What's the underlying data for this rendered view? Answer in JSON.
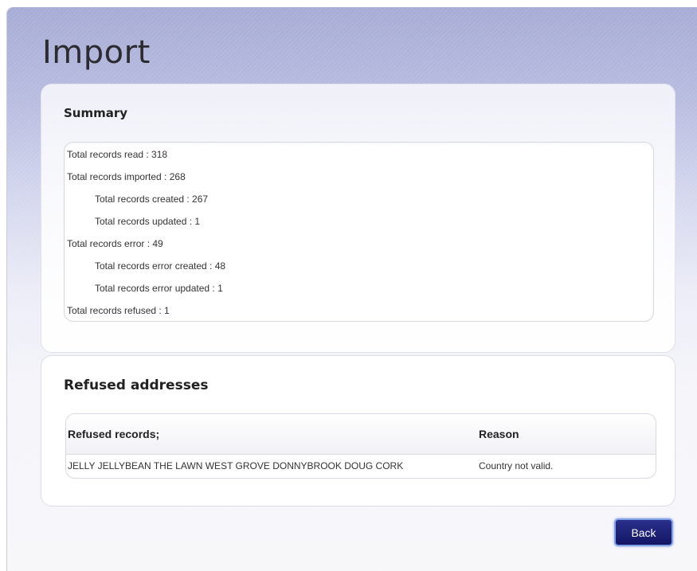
{
  "page": {
    "title": "Import"
  },
  "summary": {
    "title": "Summary",
    "lines": [
      "Total records read : 318",
      "Total records imported : 268",
      "Total records created : 267",
      "Total records updated : 1",
      "Total records error : 49",
      "Total records error created : 48",
      "Total records error updated : 1",
      "Total records refused : 1"
    ]
  },
  "refused": {
    "title": "Refused addresses",
    "columns": [
      "Refused records;",
      "Reason"
    ],
    "rows": [
      [
        "JELLY JELLYBEAN THE LAWN WEST GROVE DONNYBROOK DOUG CORK",
        "Country not valid."
      ]
    ]
  },
  "actions": {
    "back_label": "Back"
  },
  "colors": {
    "button": "#1c1f78",
    "header_gradient": "#a7acd6"
  }
}
